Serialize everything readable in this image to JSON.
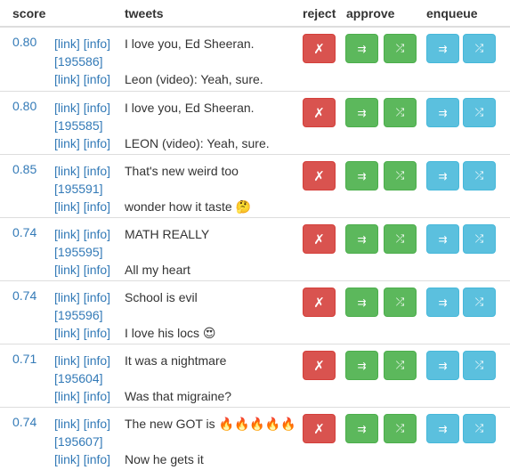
{
  "header": {
    "score": "score",
    "tweets": "tweets",
    "reject": "reject",
    "approve": "approve",
    "enqueue": "enqueue"
  },
  "link_label": "[link]",
  "info_label": "[info]",
  "icons": {
    "reject": "✗",
    "approve_append": "⇉",
    "approve_shuffle": "⤮",
    "enqueue_append": "⇉",
    "enqueue_shuffle": "⤮"
  },
  "colors": {
    "reject": "#d9534f",
    "approve": "#5cb85c",
    "enqueue": "#5bc0de",
    "link": "#337ab7"
  },
  "rows": [
    {
      "score": "0.80",
      "id": "[195586]",
      "tweet1": "I love you, Ed Sheeran.",
      "tweet2": "Leon (video): Yeah, sure."
    },
    {
      "score": "0.80",
      "id": "[195585]",
      "tweet1": "I love you, Ed Sheeran.",
      "tweet2": "LEON (video): Yeah, sure."
    },
    {
      "score": "0.85",
      "id": "[195591]",
      "tweet1": "That's new weird too",
      "tweet2": "wonder how it taste 🤔"
    },
    {
      "score": "0.74",
      "id": "[195595]",
      "tweet1": "MATH REALLY",
      "tweet2": "All my heart"
    },
    {
      "score": "0.74",
      "id": "[195596]",
      "tweet1": "School is evil",
      "tweet2": "I love his locs 😍"
    },
    {
      "score": "0.71",
      "id": "[195604]",
      "tweet1": "It was a nightmare",
      "tweet2": "Was that migraine?"
    },
    {
      "score": "0.74",
      "id": "[195607]",
      "tweet1": "The new GOT is 🔥🔥🔥🔥🔥",
      "tweet2": "Now he gets it"
    }
  ]
}
